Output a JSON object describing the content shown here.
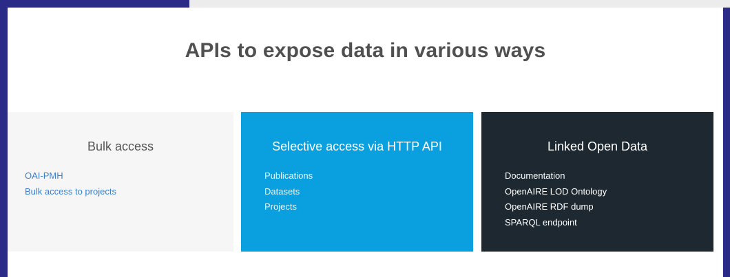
{
  "title": "APIs to expose data in various ways",
  "panels": {
    "bulk": {
      "title": "Bulk access",
      "links": [
        "OAI-PMH",
        "Bulk access to projects"
      ]
    },
    "http": {
      "title": "Selective access via HTTP API",
      "links": [
        "Publications",
        "Datasets",
        "Projects"
      ]
    },
    "lod": {
      "title": "Linked Open Data",
      "links": [
        "Documentation",
        "OpenAIRE LOD Ontology",
        "OpenAIRE RDF dump",
        "SPARQL endpoint"
      ]
    }
  },
  "colors": {
    "frame": "#2b2a86",
    "bulk_bg": "#f6f6f6",
    "http_bg": "#0aa0df",
    "lod_bg": "#1d2830",
    "link_blue": "#3a7fd0"
  }
}
